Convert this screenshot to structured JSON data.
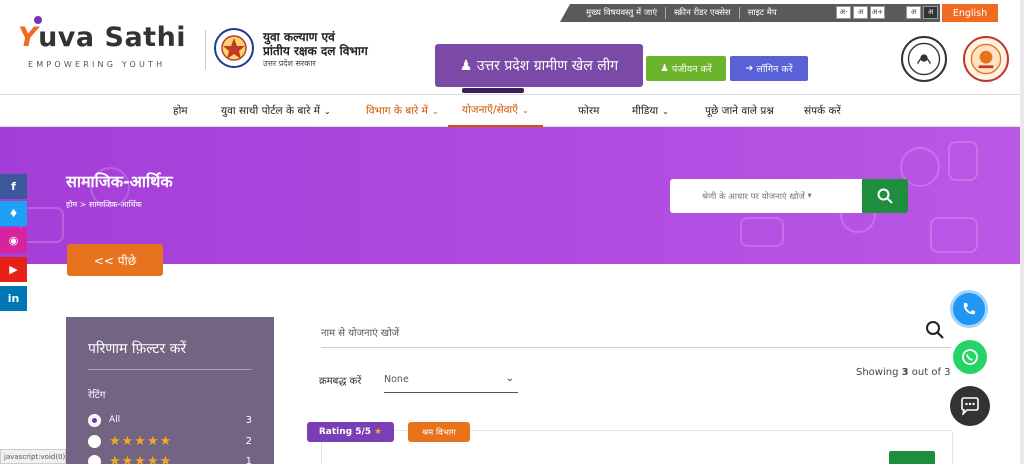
{
  "utility": {
    "links": [
      "मुख्य विषयवस्तु में जाएं",
      "स्क्रीन रीडर एक्सेस",
      "साइट मैप"
    ],
    "font_sizes": [
      "अ-",
      "अ",
      "अ+"
    ],
    "lang_toggle": [
      "अ",
      "अ"
    ],
    "english": "English"
  },
  "logo": {
    "y": "Y",
    "uva": "uva",
    "sathi": "Sathi",
    "tagline": "EMPOWERING YOUTH"
  },
  "department": {
    "line1": "युवा कल्याण एवं",
    "line2": "प्रांतीय रक्षक दल विभाग",
    "sub": "उत्तर प्रदेश सरकार"
  },
  "header": {
    "league": "उत्तर प्रदेश ग्रामीण खेल लीग",
    "register": "पंजीयन करें",
    "login": "लॉगिन करें"
  },
  "nav": {
    "items": [
      {
        "label": "होम"
      },
      {
        "label": "युवा साथी पोर्टल के बारे में"
      },
      {
        "label": "विभाग के बारे में"
      },
      {
        "label": "योजनाएँ/सेवाएँ"
      },
      {
        "label": "फोरम"
      },
      {
        "label": "मीडिया"
      },
      {
        "label": "पूछे जाने वाले प्रश्न"
      },
      {
        "label": "संपर्क करें"
      }
    ]
  },
  "banner": {
    "title": "सामाजिक-आर्थिक",
    "breadcrumb_home": "होम",
    "breadcrumb_sep": ">",
    "breadcrumb_current": "सामाजिक-आर्थिक",
    "category_search": "श्रेणी के आधार पर योजनाएं खोजें",
    "back": "<< पीछे"
  },
  "social": [
    "f",
    "t",
    "ig",
    "yt",
    "in"
  ],
  "filter": {
    "title": "परिणाम फ़िल्टर करें",
    "rating_label": "रेटिंग",
    "options": [
      {
        "label": "All",
        "stars": "",
        "count": "3"
      },
      {
        "label": "",
        "stars": "★★★★★",
        "count": "2"
      },
      {
        "label": "",
        "stars": "★★★★★",
        "count": "1"
      }
    ]
  },
  "results": {
    "name_search_placeholder": "नाम से योजनाएं खोजें",
    "sort_label": "क्रमबद्ध करें",
    "sort_value": "None",
    "showing_prefix": "Showing",
    "showing_count": "3",
    "showing_suffix": "out of 3"
  },
  "card": {
    "rating": "Rating 5/5",
    "dept": "श्रम विभाग"
  },
  "status_bar": "javascript:void(0)",
  "colors": {
    "accent_orange": "#f26a21",
    "purple": "#7b4aa6",
    "banner_purple": "#b04ce0",
    "green": "#1e8e3e"
  }
}
